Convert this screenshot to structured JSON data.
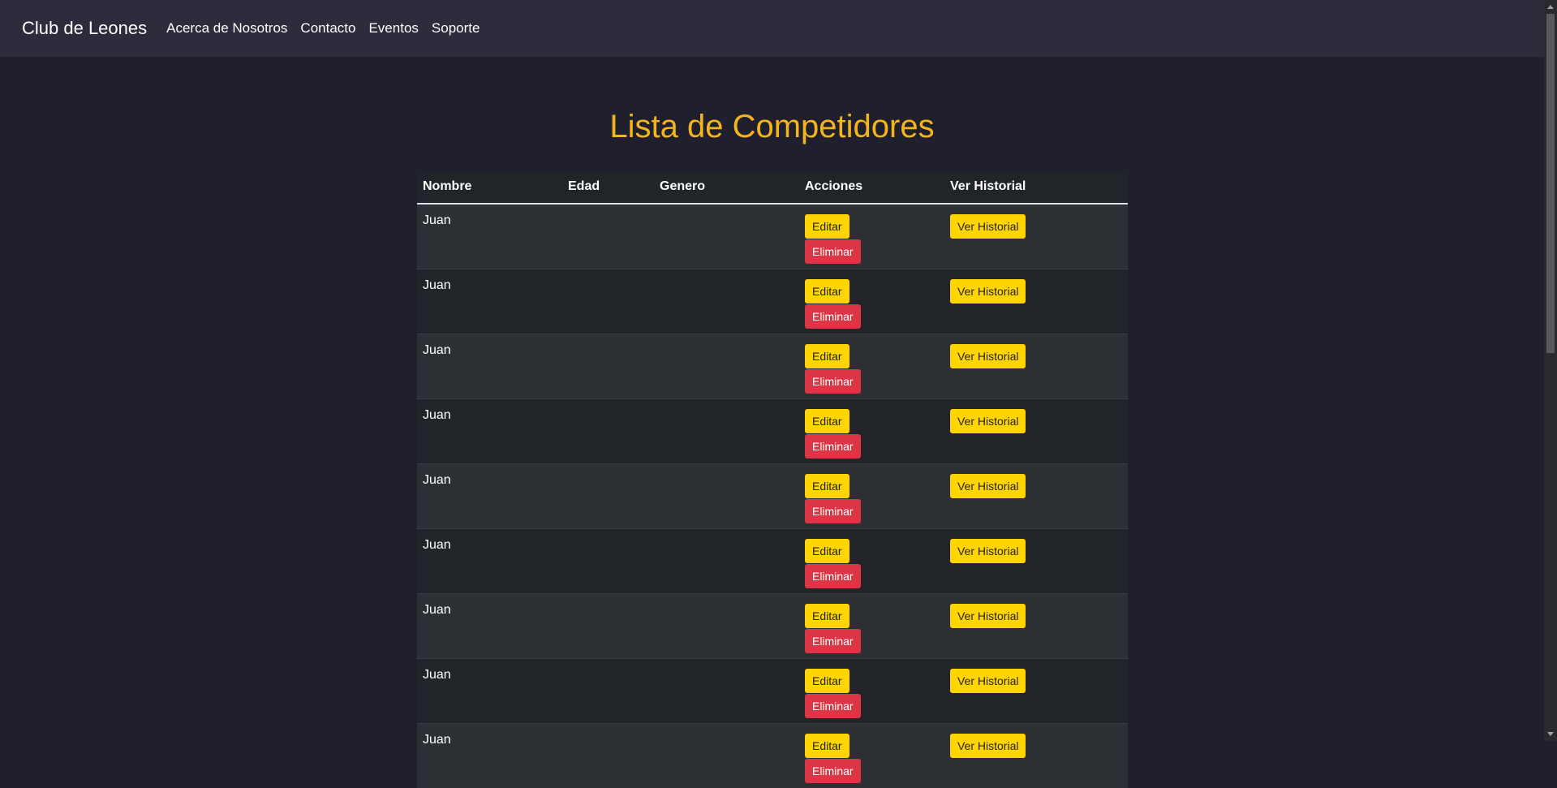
{
  "navbar": {
    "brand": "Club de Leones",
    "links": [
      "Acerca de Nosotros",
      "Contacto",
      "Eventos",
      "Soporte"
    ]
  },
  "page": {
    "title": "Lista de Competidores"
  },
  "table": {
    "headers": [
      "Nombre",
      "Edad",
      "Genero",
      "Acciones",
      "Ver Historial"
    ],
    "rows": [
      {
        "nombre": "Juan",
        "edad": "",
        "genero": ""
      },
      {
        "nombre": "Juan",
        "edad": "",
        "genero": ""
      },
      {
        "nombre": "Juan",
        "edad": "",
        "genero": ""
      },
      {
        "nombre": "Juan",
        "edad": "",
        "genero": ""
      },
      {
        "nombre": "Juan",
        "edad": "",
        "genero": ""
      },
      {
        "nombre": "Juan",
        "edad": "",
        "genero": ""
      },
      {
        "nombre": "Juan",
        "edad": "",
        "genero": ""
      },
      {
        "nombre": "Juan",
        "edad": "",
        "genero": ""
      },
      {
        "nombre": "Juan",
        "edad": "",
        "genero": ""
      }
    ],
    "edit_label": "Editar",
    "delete_label": "Eliminar",
    "history_label": "Ver Historial"
  },
  "colors": {
    "title": "#f2b51c",
    "warning": "#ffd500",
    "danger": "#dc3545",
    "navbar": "#2c2c3c",
    "background": "#1f1f2e"
  }
}
